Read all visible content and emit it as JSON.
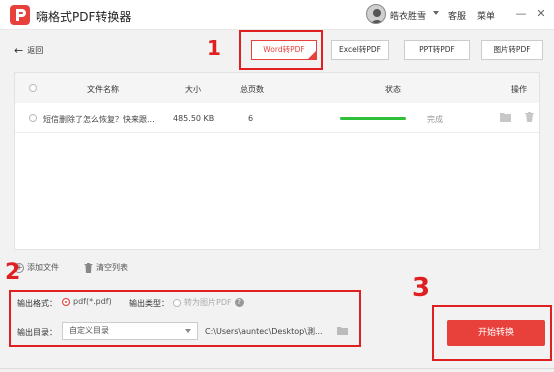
{
  "app": {
    "title": "嗨格式PDF转换器"
  },
  "user": {
    "name": "皓衣胜雪"
  },
  "header": {
    "support": "客服",
    "menu": "菜单",
    "minimize": "—",
    "close": "✕"
  },
  "toolbar": {
    "back": "返回",
    "back_arrow": "←",
    "tabs": [
      {
        "label": "Word转PDF",
        "active": true
      },
      {
        "label": "Excel转PDF",
        "active": false
      },
      {
        "label": "PPT转PDF",
        "active": false
      },
      {
        "label": "图片转PDF",
        "active": false
      }
    ]
  },
  "table": {
    "columns": [
      "文件名称",
      "大小",
      "总页数",
      "状态",
      "操作"
    ],
    "rows": [
      {
        "name": "短信删除了怎么恢复？快来跟...",
        "size": "485.50 KB",
        "pages": "6",
        "progress": 1.0,
        "status": "完成"
      }
    ]
  },
  "file_actions": {
    "add": "添加文件",
    "clear": "清空列表"
  },
  "settings": {
    "output_format_label": "输出格式：",
    "format_option": "pdf(*.pdf)",
    "output_type_label": "输出类型：",
    "type_option": "转为图片PDF",
    "output_dir_label": "输出目录：",
    "dir_select": "自定义目录",
    "dir_path": "C:\\Users\\auntec\\Desktop\\測..."
  },
  "start_button": "开始转换",
  "annotations": {
    "one": "1",
    "two": "2",
    "three": "3"
  },
  "colors": {
    "accent": "#e8413c",
    "annotation": "#e02020",
    "progress": "#2fbf3a"
  }
}
